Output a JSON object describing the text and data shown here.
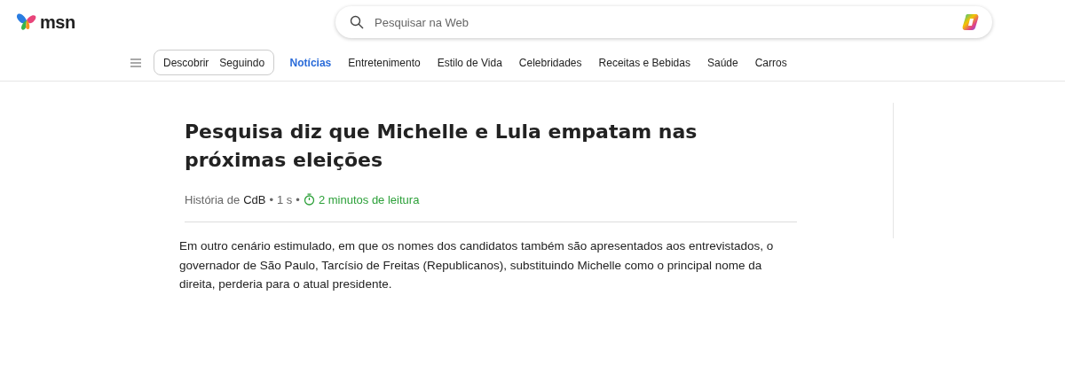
{
  "header": {
    "logo": "msn",
    "search": {
      "placeholder": "Pesquisar na Web"
    }
  },
  "feed_toggle": [
    {
      "label": "Descobrir"
    },
    {
      "label": "Seguindo"
    }
  ],
  "nav": [
    {
      "label": "Notícias",
      "selected": true
    },
    {
      "label": "Entretenimento",
      "selected": false
    },
    {
      "label": "Estilo de Vida",
      "selected": false
    },
    {
      "label": "Celebridades",
      "selected": false
    },
    {
      "label": "Receitas e Bebidas",
      "selected": false
    },
    {
      "label": "Saúde",
      "selected": false
    },
    {
      "label": "Carros",
      "selected": false
    }
  ],
  "article": {
    "title": "Pesquisa diz que Michelle e Lula empatam nas próximas eleições",
    "byline_prefix": "História de",
    "source": "CdB",
    "separator_1": "•",
    "age": "1 s",
    "separator_2": "•",
    "read_time": "2 minutos de leitura",
    "body": "Em outro cenário estimulado, em que os nomes dos candidatos também são apresentados aos entrevistados, o governador de São Paulo, Tarcísio de Freitas (Republicanos), substituindo Michelle como o principal nome da direita, perderia para o atual presidente."
  }
}
